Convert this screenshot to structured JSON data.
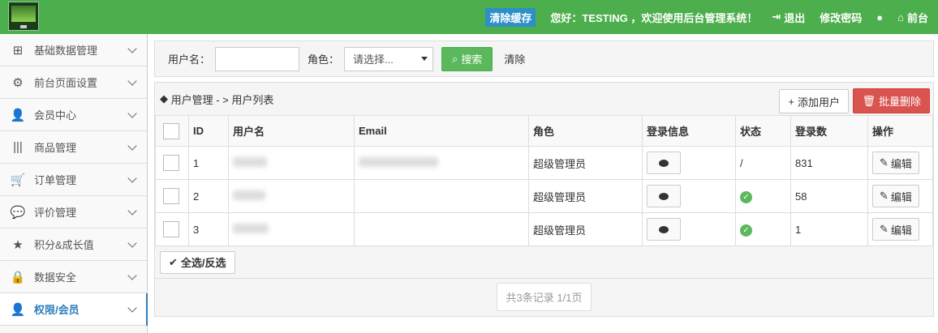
{
  "topbar": {
    "clear_cache": "清除缓存",
    "greeting": "您好：TESTING ，欢迎使用后台管理系统！",
    "logout": "退出",
    "change_password": "修改密码",
    "frontend": "前台"
  },
  "sidebar": {
    "items": [
      {
        "label": "基础数据管理",
        "icon": "sitemap-icon"
      },
      {
        "label": "前台页面设置",
        "icon": "gears-icon"
      },
      {
        "label": "会员中心",
        "icon": "user-icon"
      },
      {
        "label": "商品管理",
        "icon": "barcode-icon"
      },
      {
        "label": "订单管理",
        "icon": "cart-icon"
      },
      {
        "label": "评价管理",
        "icon": "comments-icon"
      },
      {
        "label": "积分&成长值",
        "icon": "star-icon"
      },
      {
        "label": "数据安全",
        "icon": "lock-icon"
      },
      {
        "label": "权限/会员",
        "icon": "user-icon",
        "active": true
      }
    ]
  },
  "search": {
    "username_label": "用户名：",
    "role_label": "角色：",
    "role_value": "请选择...",
    "search_label": "搜索",
    "clear_label": "清除"
  },
  "panel": {
    "breadcrumb": "用户管理 - > 用户列表",
    "add_label": "添加用户",
    "delete_label": "批量删除"
  },
  "table": {
    "headers": [
      "ID",
      "用户名",
      "Email",
      "角色",
      "登录信息",
      "状态",
      "登录数",
      "操作"
    ],
    "rows": [
      {
        "id": "1",
        "role": "超级管理员",
        "status": "/",
        "logins": "831"
      },
      {
        "id": "2",
        "role": "超级管理员",
        "status": "ok",
        "logins": "58"
      },
      {
        "id": "3",
        "role": "超级管理员",
        "status": "ok",
        "logins": "1"
      }
    ],
    "edit_label": "编辑"
  },
  "footer": {
    "select_all_label": "全选/反选",
    "pager_text": "共3条记录 1/1页"
  },
  "colors": {
    "topbar": "#4cae4c",
    "accent": "#2b7dbc",
    "danger": "#d9534f",
    "success": "#5cb85c"
  }
}
